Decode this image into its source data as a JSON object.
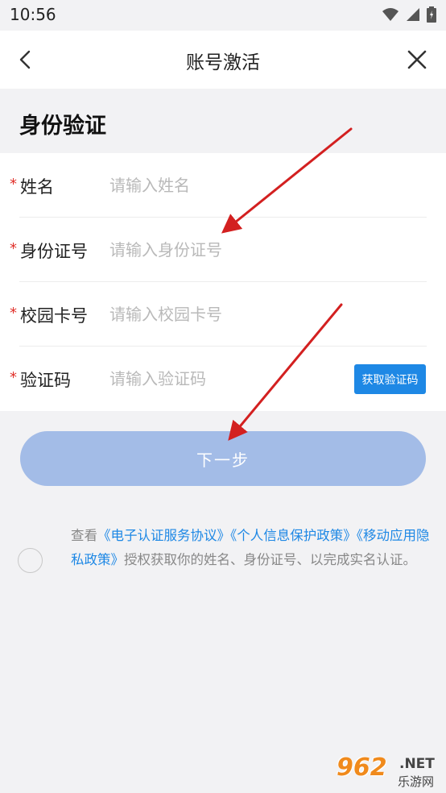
{
  "status_bar": {
    "time": "10:56",
    "icons": [
      "wifi-icon",
      "signal-icon",
      "battery-icon"
    ]
  },
  "nav": {
    "title": "账号激活",
    "back_icon": "chevron-left-icon",
    "close_icon": "close-icon"
  },
  "section": {
    "title": "身份验证"
  },
  "form": {
    "required_mark": "*",
    "name": {
      "label": "姓名",
      "placeholder": "请输入姓名"
    },
    "id_number": {
      "label": "身份证号",
      "placeholder": "请输入身份证号"
    },
    "campus_card": {
      "label": "校园卡号",
      "placeholder": "请输入校园卡号"
    },
    "verify_code": {
      "label": "验证码",
      "placeholder": "请输入验证码",
      "button": "获取验证码"
    }
  },
  "next_button": "下一步",
  "agreement": {
    "prefix": "查看",
    "link1": "《电子认证服务协议》",
    "link2": "《个人信息保护政策》",
    "link3": "《移动应用隐私政策》",
    "suffix": "授权获取你的姓名、身份证号、以完成实名认证。"
  },
  "watermark": {
    "number": "962",
    "net": ".NET",
    "site": "乐游网"
  },
  "colors": {
    "accent": "#1e88e5",
    "button_disabled": "#a3bce7",
    "required": "#e0302a",
    "arrow": "#d32020"
  }
}
